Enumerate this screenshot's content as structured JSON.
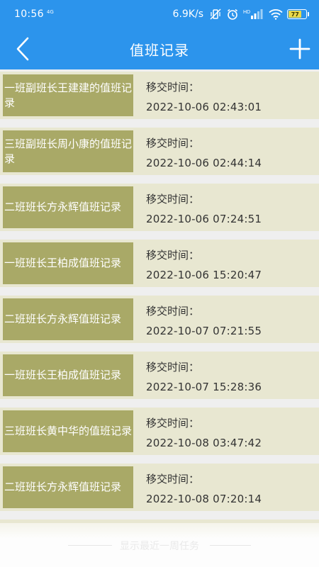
{
  "status_bar": {
    "time": "10:56",
    "small_indicator": "4G",
    "net_speed": "6.9K/s",
    "network_label": "HD",
    "battery_level": "77",
    "icons": [
      "vibrate-off-icon",
      "alarm-icon",
      "signal-icon",
      "wifi-icon",
      "battery-icon"
    ]
  },
  "nav": {
    "title": "值班记录",
    "back_icon": "chevron-left-icon",
    "add_icon": "plus-icon"
  },
  "records": [
    {
      "title": "一班副班长王建建的值班记录",
      "label": "移交时间：",
      "time": "2022-10-06 02:43:01"
    },
    {
      "title": "三班副班长周小康的值班记录",
      "label": "移交时间：",
      "time": "2022-10-06 02:44:14"
    },
    {
      "title": "二班班长方永辉值班记录",
      "label": "移交时间：",
      "time": "2022-10-06 07:24:51"
    },
    {
      "title": "一班班长王柏成值班记录",
      "label": "移交时间：",
      "time": "2022-10-06 15:20:47"
    },
    {
      "title": "二班班长方永辉值班记录",
      "label": "移交时间：",
      "time": "2022-10-07 07:21:55"
    },
    {
      "title": "一班班长王柏成值班记录",
      "label": "移交时间：",
      "time": "2022-10-07 15:28:36"
    },
    {
      "title": "三班班长黄中华的值班记录",
      "label": "移交时间：",
      "time": "2022-10-08 03:47:42"
    },
    {
      "title": "二班班长方永辉值班记录",
      "label": "移交时间：",
      "time": "2022-10-08 07:20:14"
    }
  ],
  "footer": {
    "text": "显示最近一周任务"
  },
  "colors": {
    "primary": "#2c94ec",
    "card_bg": "#e8e7d1",
    "title_bg": "#a9a967",
    "battery": "#e9d84a"
  }
}
